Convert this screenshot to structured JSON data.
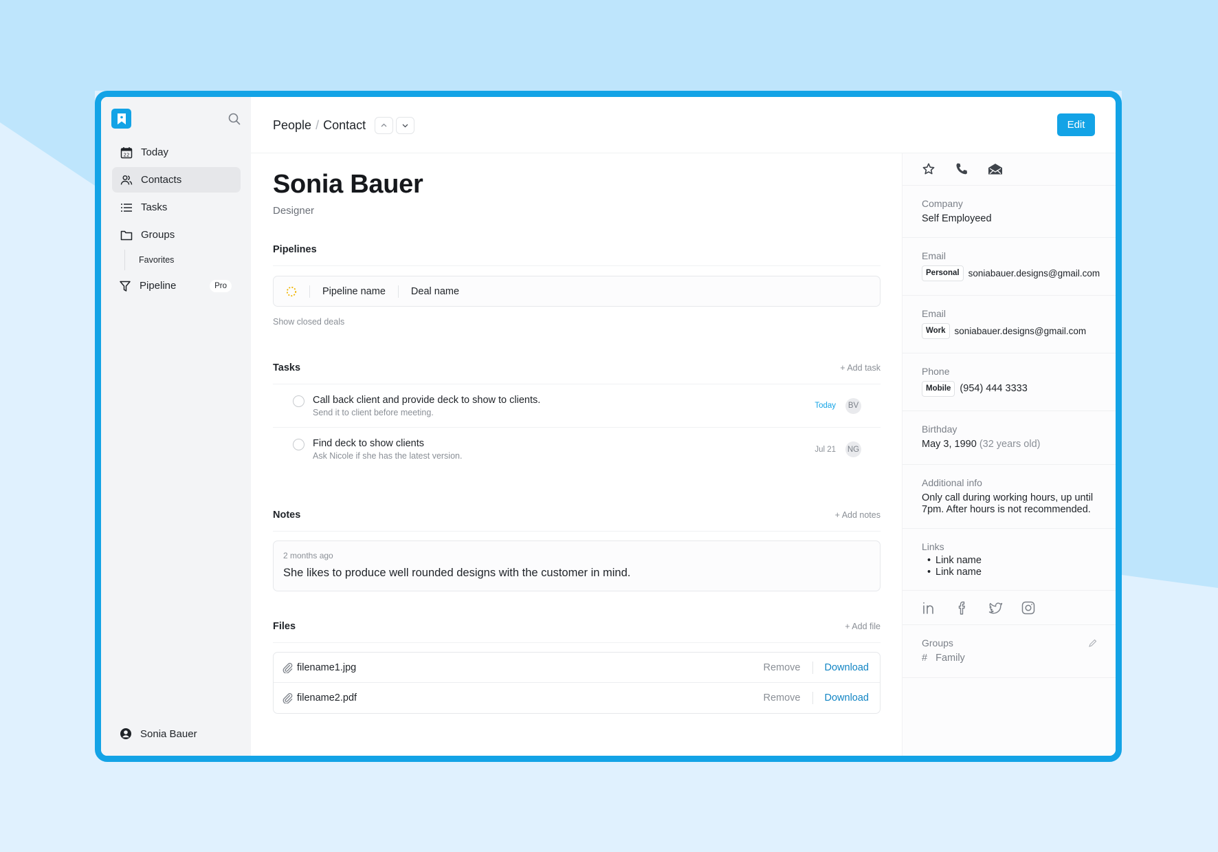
{
  "sidebar": {
    "logo": "bookmark-logo",
    "search_icon": "search-icon",
    "items": [
      {
        "label": "Today",
        "icon": "calendar-icon",
        "badge_text": "22",
        "active": false
      },
      {
        "label": "Contacts",
        "icon": "users-icon",
        "active": true
      },
      {
        "label": "Tasks",
        "icon": "list-icon",
        "active": false
      },
      {
        "label": "Groups",
        "icon": "folder-icon",
        "active": false
      }
    ],
    "sub_items": [
      {
        "label": "Favorites"
      }
    ],
    "pipeline": {
      "label": "Pipeline",
      "icon": "filter-icon",
      "badge": "Pro"
    },
    "user": {
      "name": "Sonia Bauer",
      "icon": "user-circle-icon"
    }
  },
  "header": {
    "breadcrumb": [
      "People",
      "Contact"
    ],
    "separator": "/",
    "edit_label": "Edit"
  },
  "contact": {
    "name": "Sonia Bauer",
    "role": "Designer"
  },
  "pipelines": {
    "title": "Pipelines",
    "pipeline_name": "Pipeline name",
    "deal_name": "Deal name",
    "show_closed": "Show closed deals"
  },
  "tasks": {
    "title": "Tasks",
    "add_label": "+ Add task",
    "items": [
      {
        "title": "Call back client and provide deck to show to clients.",
        "subtitle": "Send it to client before meeting.",
        "date": "Today",
        "assignee": "BV"
      },
      {
        "title": "Find deck to show clients",
        "subtitle": "Ask Nicole if she has the latest version.",
        "date": "Jul 21",
        "assignee": "NG"
      }
    ]
  },
  "notes": {
    "title": "Notes",
    "add_label": "+ Add notes",
    "items": [
      {
        "time": "2 months ago",
        "text": "She likes to produce well rounded designs with the customer in mind."
      }
    ]
  },
  "files": {
    "title": "Files",
    "add_label": "+ Add file",
    "remove_label": "Remove",
    "download_label": "Download",
    "items": [
      {
        "name": "filename1.jpg"
      },
      {
        "name": "filename2.pdf"
      }
    ]
  },
  "details": {
    "actions": [
      "star-icon",
      "phone-icon",
      "mail-open-icon"
    ],
    "company": {
      "label": "Company",
      "value": "Self Employeed"
    },
    "emails": [
      {
        "label": "Email",
        "tag": "Personal",
        "value": "soniabauer.designs@gmail.com"
      },
      {
        "label": "Email",
        "tag": "Work",
        "value": "soniabauer.designs@gmail.com"
      }
    ],
    "phone": {
      "label": "Phone",
      "tag": "Mobile",
      "value": "(954) 444 3333"
    },
    "birthday": {
      "label": "Birthday",
      "value": "May 3, 1990",
      "age": "(32 years old)"
    },
    "additional": {
      "label": "Additional info",
      "value": "Only call during working hours, up until 7pm. After hours is not recommended."
    },
    "links": {
      "label": "Links",
      "items": [
        "Link name",
        "Link name"
      ]
    },
    "social": [
      "linkedin-icon",
      "facebook-icon",
      "twitter-icon",
      "instagram-icon"
    ],
    "groups": {
      "label": "Groups",
      "hash": "#",
      "items": [
        "Family"
      ]
    }
  },
  "colors": {
    "accent": "#13a3e6",
    "link": "#1285c4",
    "pipeline_status": "#f0b400"
  }
}
